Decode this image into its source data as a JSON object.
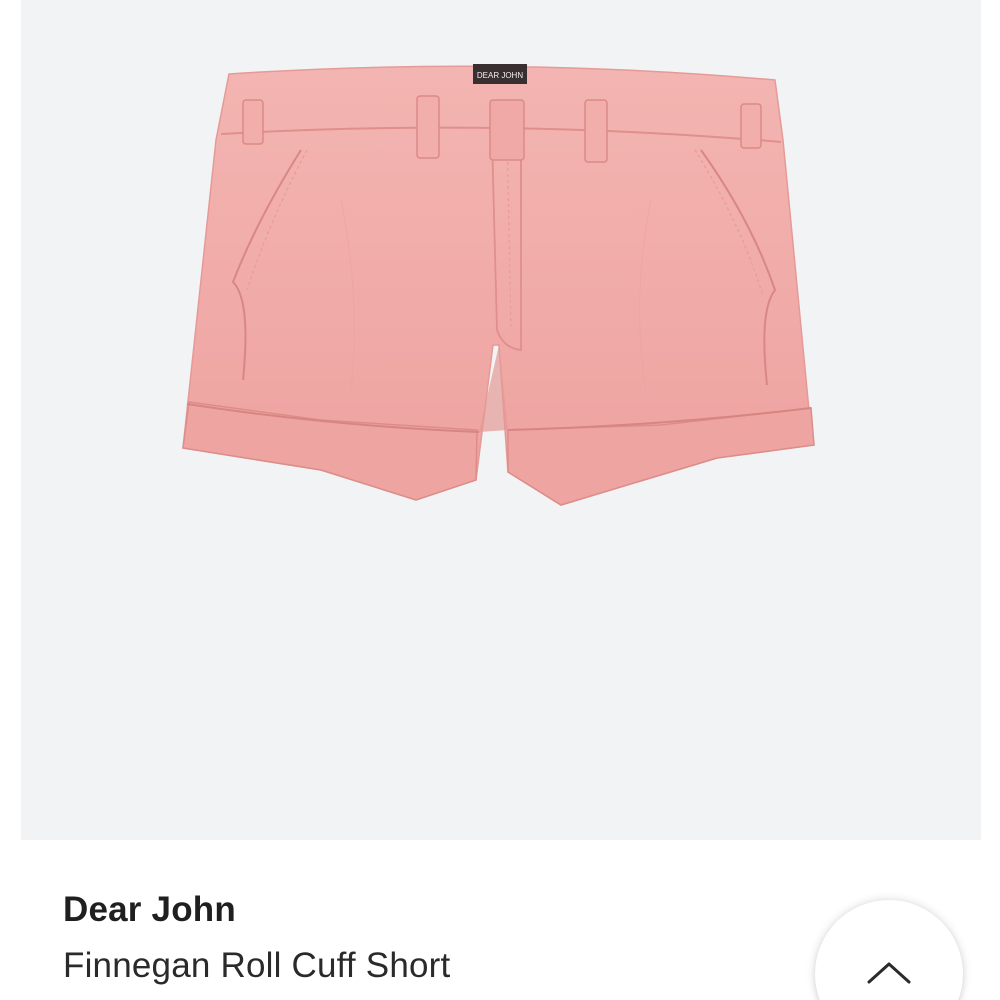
{
  "product": {
    "brand": "Dear John",
    "name": "Finnegan Roll Cuff Short",
    "image_alt": "Finnegan Roll Cuff Short",
    "label_text": "DEAR JOHN",
    "color": "#f1aaa7"
  },
  "panel": {
    "background": "#f1f3f5"
  },
  "icons": {
    "expand": "chevron-up-icon"
  }
}
